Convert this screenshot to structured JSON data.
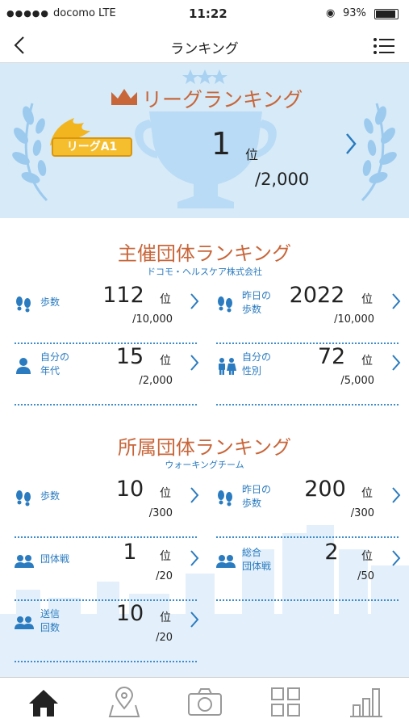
{
  "status": {
    "carrier": "docomo LTE",
    "time": "11:22",
    "battery": "93%"
  },
  "nav": {
    "title": "ランキング"
  },
  "league": {
    "title": "リーグランキング",
    "badge": "リーグA1",
    "rank": "1",
    "unit": "位",
    "total": "/2,000"
  },
  "host": {
    "title": "主催団体ランキング",
    "subtitle": "ドコモ・ヘルスケア株式会社",
    "cells": [
      {
        "label1": "歩数",
        "label2": "",
        "rank": "112",
        "unit": "位",
        "total": "/10,000",
        "icon": "footprints-icon"
      },
      {
        "label1": "昨日の",
        "label2": "歩数",
        "rank": "2022",
        "unit": "位",
        "total": "/10,000",
        "icon": "footprints-icon"
      },
      {
        "label1": "自分の",
        "label2": "年代",
        "rank": "15",
        "unit": "位",
        "total": "/2,000",
        "icon": "person-icon"
      },
      {
        "label1": "自分の",
        "label2": "性別",
        "rank": "72",
        "unit": "位",
        "total": "/5,000",
        "icon": "gender-icon"
      }
    ]
  },
  "member": {
    "title": "所属団体ランキング",
    "subtitle": "ウォーキングチーム",
    "cells": [
      {
        "label1": "歩数",
        "label2": "",
        "rank": "10",
        "unit": "位",
        "total": "/300",
        "icon": "footprints-icon"
      },
      {
        "label1": "昨日の",
        "label2": "歩数",
        "rank": "200",
        "unit": "位",
        "total": "/300",
        "icon": "footprints-icon"
      },
      {
        "label1": "団体戦",
        "label2": "",
        "rank": "1",
        "unit": "位",
        "total": "/20",
        "icon": "group-icon"
      },
      {
        "label1": "総合",
        "label2": "団体戦",
        "rank": "2",
        "unit": "位",
        "total": "/50",
        "icon": "group-icon"
      },
      {
        "label1": "送信",
        "label2": "回数",
        "rank": "10",
        "unit": "位",
        "total": "/20",
        "icon": "group-icon"
      }
    ]
  },
  "colors": {
    "accent": "#c8663a",
    "blue": "#2a7bbf",
    "header_bg": "#d6eaf8"
  },
  "tabs": [
    "home-icon",
    "map-pin-icon",
    "camera-icon",
    "grid-icon",
    "bar-chart-icon"
  ]
}
